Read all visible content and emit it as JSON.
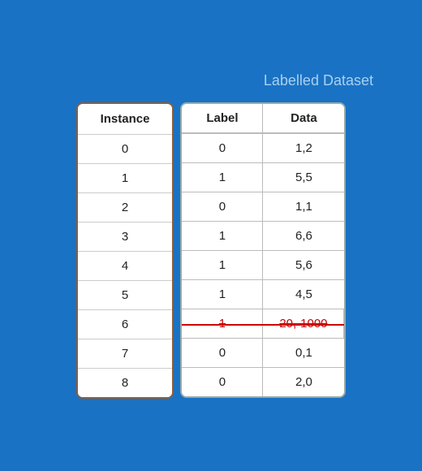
{
  "title": "Labelled Dataset",
  "instance_column": {
    "header": "Instance",
    "cells": [
      "0",
      "1",
      "2",
      "3",
      "4",
      "5",
      "6",
      "7",
      "8"
    ]
  },
  "dataset": {
    "headers": [
      "Label",
      "Data"
    ],
    "rows": [
      {
        "label": "0",
        "data": "1,2",
        "strikethrough": false
      },
      {
        "label": "1",
        "data": "5,5",
        "strikethrough": false
      },
      {
        "label": "0",
        "data": "1,1",
        "strikethrough": false
      },
      {
        "label": "1",
        "data": "6,6",
        "strikethrough": false
      },
      {
        "label": "1",
        "data": "5,6",
        "strikethrough": false
      },
      {
        "label": "1",
        "data": "4,5",
        "strikethrough": false
      },
      {
        "label": "1",
        "data": "20,-1000",
        "strikethrough": true
      },
      {
        "label": "0",
        "data": "0,1",
        "strikethrough": false
      },
      {
        "label": "0",
        "data": "2,0",
        "strikethrough": false
      }
    ]
  }
}
